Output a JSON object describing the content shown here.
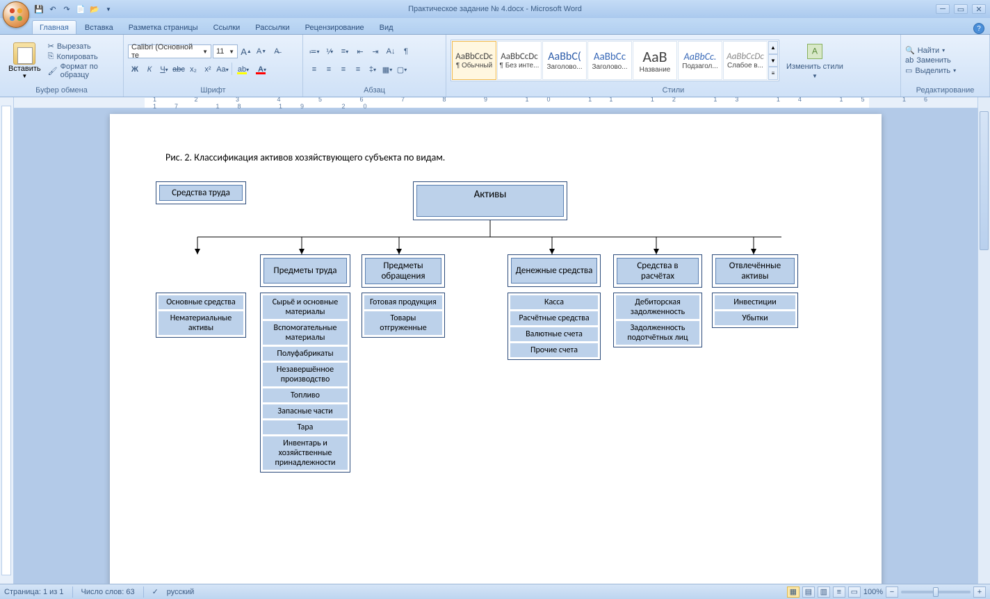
{
  "title": "Практическое задание № 4.docx - Microsoft Word",
  "tabs": [
    "Главная",
    "Вставка",
    "Разметка страницы",
    "Ссылки",
    "Рассылки",
    "Рецензирование",
    "Вид"
  ],
  "groups": {
    "clipboard": "Буфер обмена",
    "font": "Шрифт",
    "paragraph": "Абзац",
    "styles": "Стили",
    "editing": "Редактирование"
  },
  "clipboard": {
    "paste": "Вставить",
    "cut": "Вырезать",
    "copy": "Копировать",
    "format": "Формат по образцу"
  },
  "font": {
    "name": "Calibri (Основной те",
    "size": "11"
  },
  "style_items": [
    {
      "preview": "AaBbCcDc",
      "label": "¶ Обычный"
    },
    {
      "preview": "AaBbCcDc",
      "label": "¶ Без инте..."
    },
    {
      "preview": "AaBbC(",
      "label": "Заголово..."
    },
    {
      "preview": "AaBbCc",
      "label": "Заголово..."
    },
    {
      "preview": "AaB",
      "label": "Название"
    },
    {
      "preview": "AaBbCc.",
      "label": "Подзагол..."
    },
    {
      "preview": "AaBbCcDc",
      "label": "Слабое в..."
    }
  ],
  "change_styles": "Изменить стили",
  "editing": {
    "find": "Найти",
    "replace": "Заменить",
    "select": "Выделить"
  },
  "status": {
    "page": "Страница: 1 из 1",
    "words": "Число слов: 63",
    "lang": "русский",
    "zoom": "100%"
  },
  "doc": {
    "caption": "Рис. 2. Классификация активов хозяйствующего субъекта по видам.",
    "root": "Активы",
    "cats": [
      {
        "title": "Средства труда",
        "rows": [
          "Основные средства",
          "Нематериальные активы"
        ]
      },
      {
        "title": "Предметы труда",
        "rows": [
          "Сырьё и основные материалы",
          "Вспомогательные материалы",
          "Полуфабрикаты",
          "Незавершённое производство",
          "Топливо",
          "Запасные части",
          "Тара",
          "Инвентарь и хозяйственные принадлежности"
        ]
      },
      {
        "title": "Предметы обращения",
        "rows": [
          "Готовая продукция",
          "Товары отгруженные"
        ]
      },
      {
        "title": "Денежные средства",
        "rows": [
          "Касса",
          "Расчётные средства",
          "Валютные счета",
          "Прочие счета"
        ]
      },
      {
        "title": "Средства в расчётах",
        "rows": [
          "Дебиторская задолженность",
          "Задолженность подотчётных лиц"
        ]
      },
      {
        "title": "Отвлечённые активы",
        "rows": [
          "Инвестиции",
          "Убытки"
        ]
      }
    ]
  }
}
